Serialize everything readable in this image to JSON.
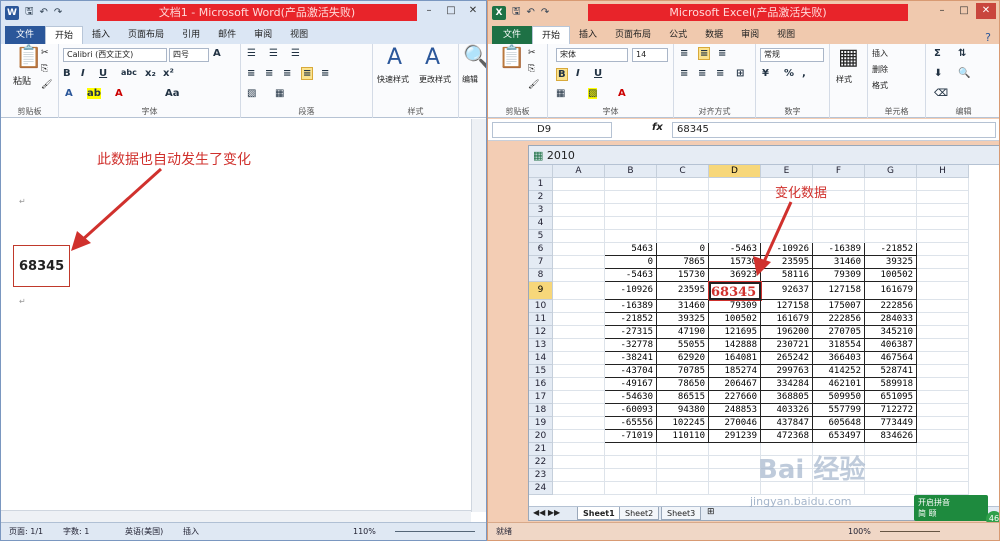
{
  "word": {
    "title": "文档1 - Microsoft Word(产品激活失败)",
    "app_icon": "W",
    "tabs": [
      "文件",
      "开始",
      "插入",
      "页面布局",
      "引用",
      "邮件",
      "审阅",
      "视图"
    ],
    "font_name": "Calibri (西文正文)",
    "font_size": "四号",
    "groups": {
      "clipboard": "剪贴板",
      "font": "字体",
      "paragraph": "段落",
      "styles": "样式",
      "editing": "编辑"
    },
    "paste_label": "粘贴",
    "quick_styles": "快速样式",
    "change_styles": "更改样式",
    "edit_label": "编辑",
    "doc_value": "68345",
    "annotation": "此数据也自动发生了变化",
    "status": {
      "page": "页面: 1/1",
      "words": "字数: 1",
      "lang": "英语(美国)",
      "mode": "插入",
      "zoom": "110%"
    }
  },
  "excel": {
    "title": "Microsoft Excel(产品激活失败)",
    "app_icon": "X",
    "tabs": [
      "文件",
      "开始",
      "插入",
      "页面布局",
      "公式",
      "数据",
      "审阅",
      "视图"
    ],
    "font_name": "宋体",
    "font_size": "14",
    "number_format": "常规",
    "groups": {
      "clipboard": "剪贴板",
      "font": "字体",
      "align": "对齐方式",
      "number": "数字",
      "styles": "样式",
      "cells": "单元格",
      "editing": "编辑"
    },
    "cells_buttons": [
      "插入",
      "删除",
      "格式"
    ],
    "styles_label": "样式",
    "name_box": "D9",
    "fx": "fx",
    "formula": "68345",
    "workbook_title": "2010",
    "annotation": "变化数据",
    "columns": [
      "A",
      "B",
      "C",
      "D",
      "E",
      "F",
      "G",
      "H"
    ],
    "rows": [
      1,
      2,
      3,
      4,
      5,
      6,
      7,
      8,
      9,
      10,
      11,
      12,
      13,
      14,
      15,
      16,
      17,
      18,
      19,
      20,
      21,
      22,
      23,
      24
    ],
    "table_start_row": 6,
    "table": [
      [
        5463,
        0,
        -5463,
        -10926,
        -16389,
        -21852
      ],
      [
        0,
        7865,
        15730,
        23595,
        31460,
        39325
      ],
      [
        -5463,
        15730,
        36923,
        58116,
        79309,
        100502
      ],
      [
        -10926,
        23595,
        68345,
        92637,
        127158,
        161679
      ],
      [
        -16389,
        31460,
        79309,
        127158,
        175007,
        222856
      ],
      [
        -21852,
        39325,
        100502,
        161679,
        222856,
        284033
      ],
      [
        -27315,
        47190,
        121695,
        196200,
        270705,
        345210
      ],
      [
        -32778,
        55055,
        142888,
        230721,
        318554,
        406387
      ],
      [
        -38241,
        62920,
        164081,
        265242,
        366403,
        467564
      ],
      [
        -43704,
        70785,
        185274,
        299763,
        414252,
        528741
      ],
      [
        -49167,
        78650,
        206467,
        334284,
        462101,
        589918
      ],
      [
        -54630,
        86515,
        227660,
        368805,
        509950,
        651095
      ],
      [
        -60093,
        94380,
        248853,
        403326,
        557799,
        712272
      ],
      [
        -65556,
        102245,
        270046,
        437847,
        605648,
        773449
      ],
      [
        -71019,
        110110,
        291239,
        472368,
        653497,
        834626
      ]
    ],
    "sheets": [
      "Sheet1",
      "Sheet2",
      "Sheet3"
    ],
    "status": {
      "ready": "就绪",
      "zoom": "100%"
    },
    "watermark": "Bai 经验",
    "watermark_url": "jingyan.baidu.com",
    "badge_label": "开启拼音",
    "badge_sub": "简 颐",
    "badge_num": "46"
  }
}
